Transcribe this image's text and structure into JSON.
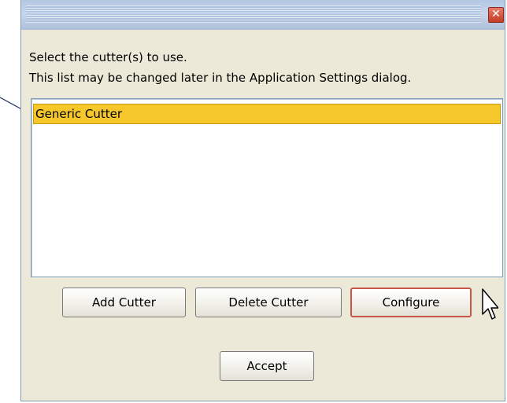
{
  "window": {
    "title": "",
    "close_glyph": "✕"
  },
  "instructions": {
    "line1": "Select the cutter(s) to use.",
    "line2": "This list may be changed later in the Application Settings dialog."
  },
  "cutter_list": {
    "items": [
      {
        "label": "Generic Cutter",
        "selected": true
      }
    ]
  },
  "buttons": {
    "add_cutter": "Add Cutter",
    "delete_cutter": "Delete Cutter",
    "configure": "Configure",
    "accept": "Accept"
  },
  "colors": {
    "selection": "#f5c72a",
    "dialog_bg": "#ece9d8",
    "titlebar": "#c8d6ea",
    "close_button": "#c33c25",
    "focus_border": "#c8574a"
  },
  "icons": {
    "close": "close-icon",
    "cursor": "mouse-pointer-icon"
  }
}
